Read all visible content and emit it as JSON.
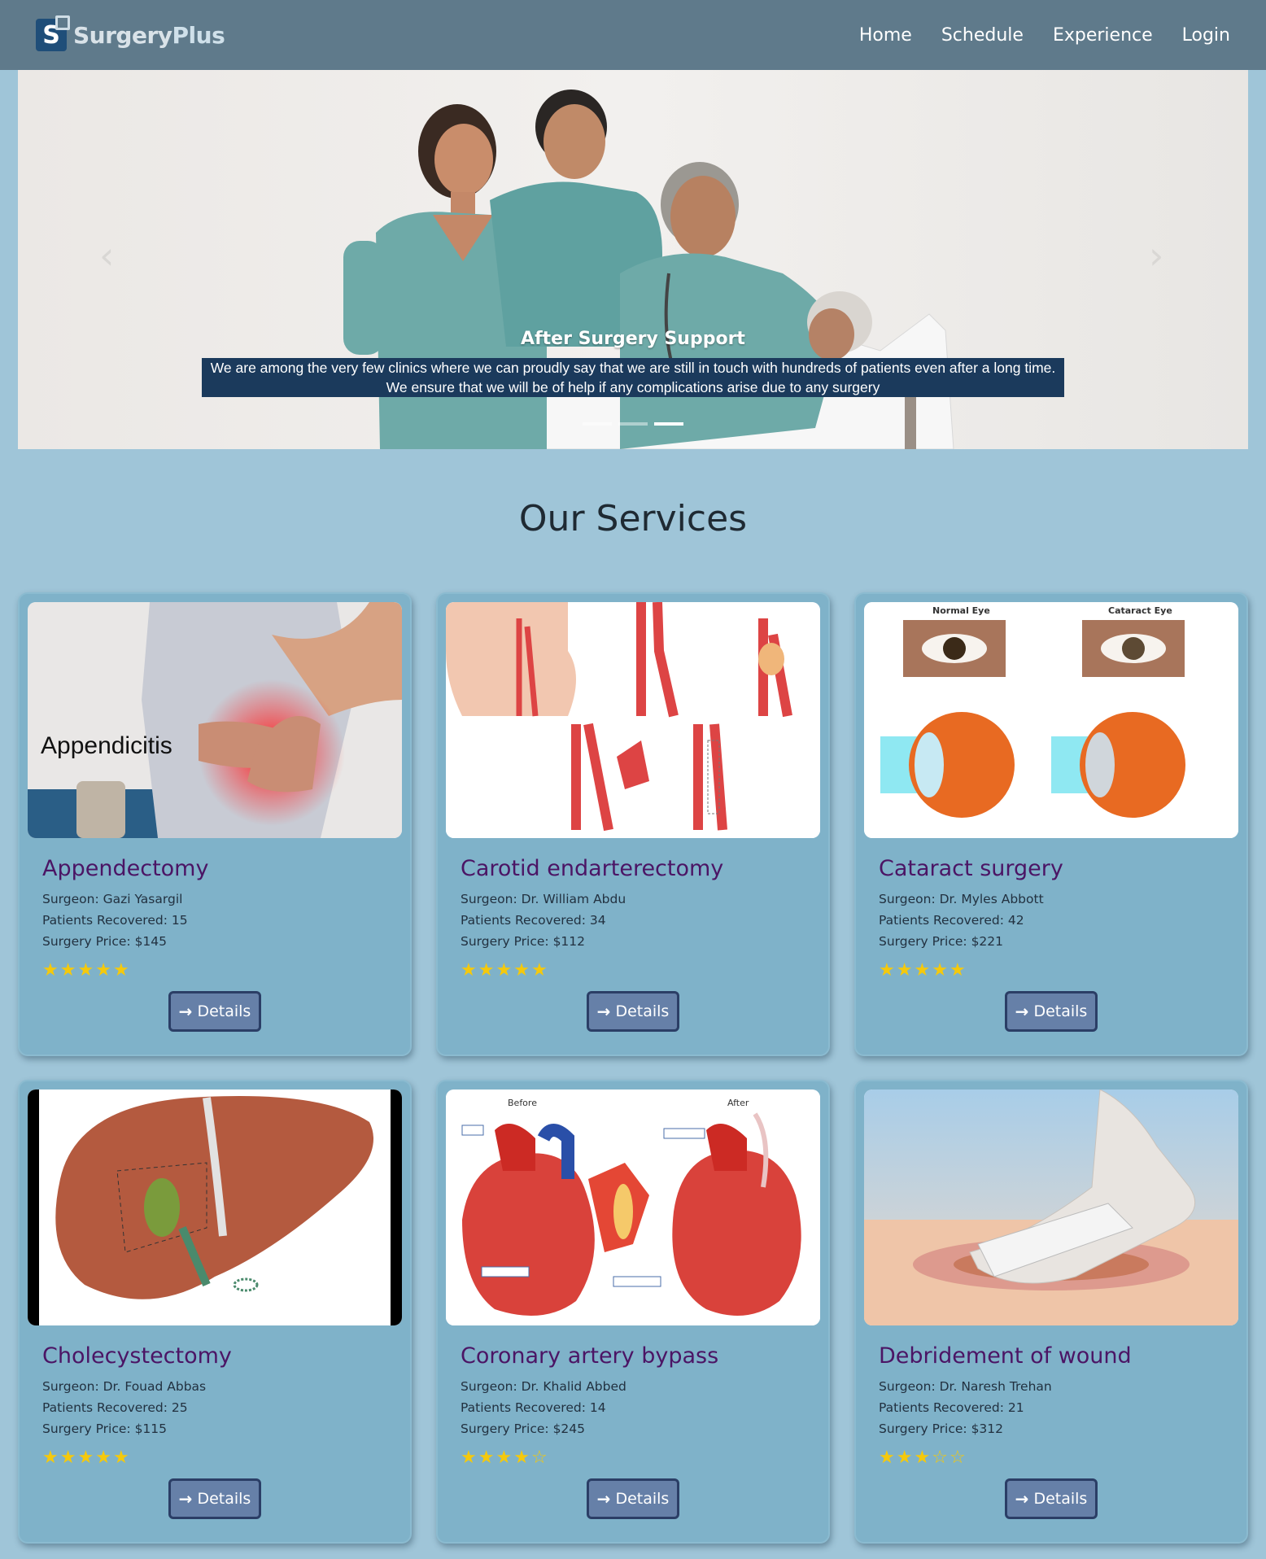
{
  "navbar": {
    "brand_letter": "S",
    "brand_name": "Surgery",
    "brand_plus": "Plus",
    "links": [
      "Home",
      "Schedule",
      "Experience",
      "Login"
    ]
  },
  "hero": {
    "caption_title": "After Surgery Support",
    "caption_text": "We are among the very few clinics where we can proudly say that we are still in touch with hundreds of patients even after a long time. We ensure that we will be of help if any complications arise due to any surgery",
    "prev_icon": "chevron-left-icon",
    "next_icon": "chevron-right-icon",
    "active_slide": 2,
    "slide_count": 3
  },
  "services": {
    "title": "Our Services",
    "details_label": "Details",
    "cards": [
      {
        "name": "Appendectomy",
        "surgeon": "Surgeon: Gazi Yasargil",
        "recovered": "Patients Recovered: 15",
        "price": "Surgery Price: $145",
        "rating": 5,
        "image_label": "Appendicitis"
      },
      {
        "name": "Carotid endarterectomy",
        "surgeon": "Surgeon: Dr. William Abdu",
        "recovered": "Patients Recovered: 34",
        "price": "Surgery Price: $112",
        "rating": 5
      },
      {
        "name": "Cataract surgery",
        "surgeon": "Surgeon: Dr. Myles Abbott",
        "recovered": "Patients Recovered: 42",
        "price": "Surgery Price: $221",
        "rating": 5,
        "image_left": "Normal Eye",
        "image_right": "Cataract Eye"
      },
      {
        "name": "Cholecystectomy",
        "surgeon": "Surgeon: Dr. Fouad Abbas",
        "recovered": "Patients Recovered: 25",
        "price": "Surgery Price: $115",
        "rating": 5
      },
      {
        "name": "Coronary artery bypass",
        "surgeon": "Surgeon: Dr. Khalid Abbed",
        "recovered": "Patients Recovered: 14",
        "price": "Surgery Price: $245",
        "rating": 4,
        "image_left": "Before",
        "image_right": "After"
      },
      {
        "name": "Debridement of wound",
        "surgeon": "Surgeon: Dr. Naresh Trehan",
        "recovered": "Patients Recovered: 21",
        "price": "Surgery Price: $312",
        "rating": 3
      }
    ]
  },
  "colors": {
    "navbar": "#5f7a8b",
    "page_bg": "#9fc5d8",
    "card_bg": "#7fb2c9",
    "card_title": "#4b1565",
    "button_bg": "#6680a8",
    "star": "#f5c90c",
    "caption_bg": "#1b3a5c"
  }
}
